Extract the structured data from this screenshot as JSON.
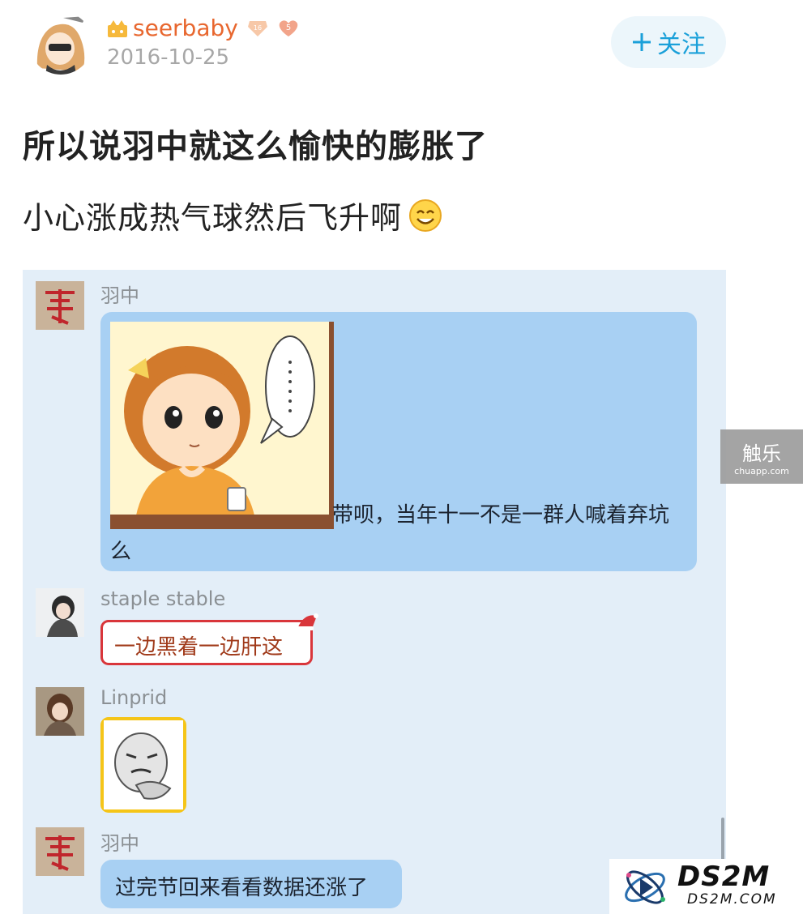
{
  "post": {
    "author": "seerbaby",
    "level_badge": "16",
    "fan_badge": "5",
    "date": "2016-10-25",
    "follow_label": "关注",
    "title": "所以说羽中就这么愉快的膨胀了",
    "subtitle": "小心涨成热气球然后飞升啊"
  },
  "chat": {
    "messages": [
      {
        "sender": "羽中",
        "text": "带呗，当年十一不是一群人喊着弃坑",
        "text2": "么"
      },
      {
        "sender": "staple stable",
        "text": "一边黑着一边肝这"
      },
      {
        "sender": "Linprid",
        "text": ""
      },
      {
        "sender": "羽中",
        "text": "过完节回来看看数据还涨了"
      }
    ]
  },
  "watermarks": {
    "side_title": "触乐",
    "side_url": "chuapp.com",
    "corner_title": "DS2M",
    "corner_url": "DS2M.COM"
  },
  "colors": {
    "username": "#e8672f",
    "follow": "#1aa0d9",
    "chat_bg": "#e3eef8",
    "bubble_blue": "#a8d0f3",
    "red_frame": "#d9363b"
  }
}
